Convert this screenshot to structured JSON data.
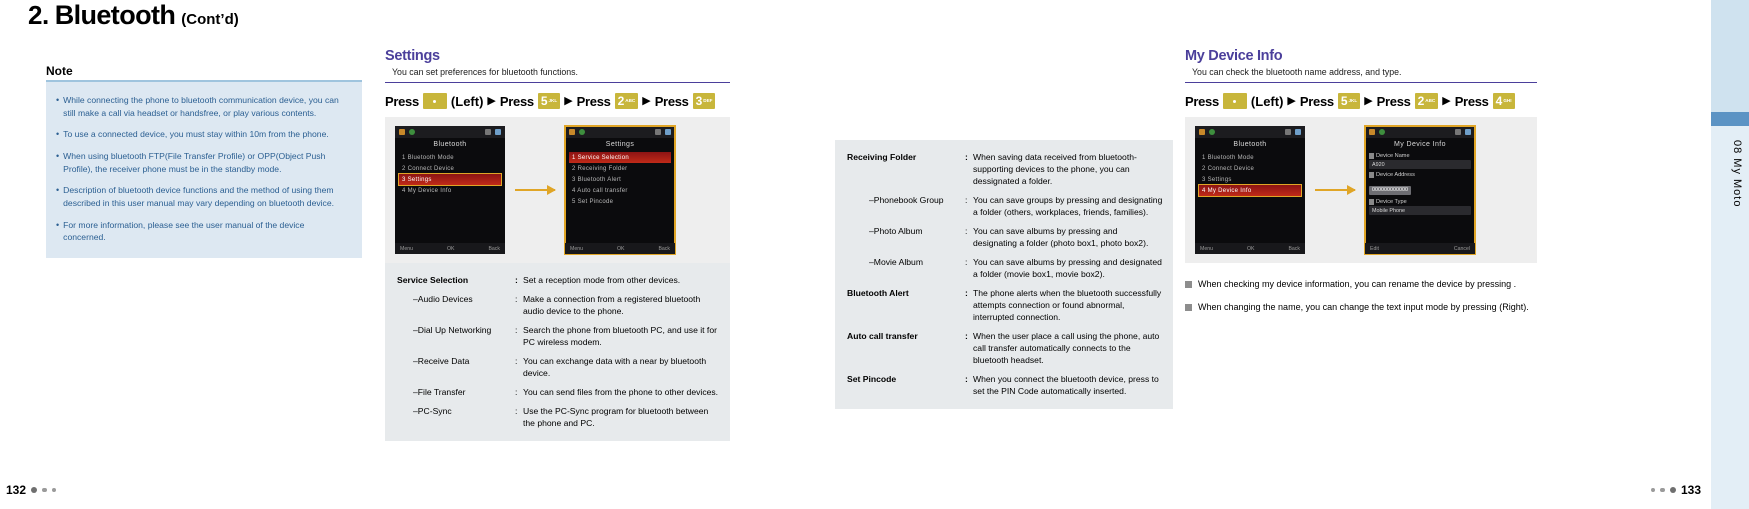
{
  "header": {
    "number": "2.",
    "title": "Bluetooth",
    "cont": "(Cont’d)"
  },
  "note": {
    "label": "Note",
    "items": [
      "While connecting the phone to bluetooth communication device, you can still make a call via headset or handsfree, or play various contents.",
      "To use a connected device, you must stay within 10m from the phone.",
      "When using bluetooth FTP(File Transfer Profile) or OPP(Object Push Profile), the receiver phone must be in the standby mode.",
      "Description of bluetooth device functions and the method of using them described in this user manual may vary depending on bluetooth device.",
      "For more information, please see the user manual of the device concerned."
    ],
    "bullet": "•"
  },
  "settings": {
    "title": "Settings",
    "subtitle": "You can set preferences for bluetooth functions.",
    "press_label": "Press",
    "left_label": "(Left)",
    "arrow": "▶",
    "keys": [
      {
        "type": "nav",
        "digit": "",
        "letters": ""
      },
      {
        "type": "num",
        "digit": "5",
        "letters": "JKL"
      },
      {
        "type": "num",
        "digit": "2",
        "letters": "ABC"
      },
      {
        "type": "num",
        "digit": "3",
        "letters": "DEF"
      }
    ],
    "phone_left": {
      "title": "Bluetooth",
      "items": [
        "1 Bluetooth Mode",
        "2 Connect Device",
        "3 Settings",
        "4 My Device Info"
      ],
      "selected_index": 2,
      "soft_left": "Menu",
      "soft_mid": "OK",
      "soft_right": "Back"
    },
    "phone_right": {
      "title": "Settings",
      "items": [
        "1 Service Selection",
        "2 Receiving Folder",
        "3 Bluetooth Alert",
        "4 Auto call transfer",
        "5 Set Pincode"
      ],
      "selected_index": 0,
      "soft_left": "Menu",
      "soft_mid": "OK",
      "soft_right": "Back"
    },
    "definitions": [
      {
        "term": "Service Selection",
        "bold": true,
        "sub": false,
        "colon": ":",
        "desc": "Set a reception mode from other devices."
      },
      {
        "term": "–Audio Devices",
        "bold": false,
        "sub": true,
        "colon": ":",
        "desc": "Make a connection from a registered bluetooth audio device to the phone."
      },
      {
        "term": "–Dial Up Networking",
        "bold": false,
        "sub": true,
        "colon": ":",
        "desc": "Search the phone from bluetooth PC, and use it for PC wireless modem."
      },
      {
        "term": "–Receive Data",
        "bold": false,
        "sub": true,
        "colon": ":",
        "desc": "You can exchange data with a near by bluetooth device."
      },
      {
        "term": "–File Transfer",
        "bold": false,
        "sub": true,
        "colon": ":",
        "desc": "You can send files from the phone to other devices."
      },
      {
        "term": "–PC-Sync",
        "bold": false,
        "sub": true,
        "colon": ":",
        "desc": "Use the PC-Sync program for bluetooth between the phone and PC."
      }
    ]
  },
  "center": {
    "definitions": [
      {
        "term": "Receiving Folder",
        "bold": true,
        "sub": false,
        "colon": ":",
        "desc": "When saving data received from bluetooth-supporting devices to the phone, you can dessignated a folder."
      },
      {
        "term": "–Phonebook Group",
        "bold": false,
        "sub": true,
        "colon": ":",
        "desc": "You can save groups by pressing  and designating a folder (others, workplaces, friends, families)."
      },
      {
        "term": "–Photo Album",
        "bold": false,
        "sub": true,
        "colon": ":",
        "desc": "You can save albums by pressing  and designating a folder (photo box1, photo box2)."
      },
      {
        "term": "–Movie Album",
        "bold": false,
        "sub": true,
        "colon": ":",
        "desc": "You can save albums by pressing  and designated a folder (movie box1, movie box2)."
      },
      {
        "term": "Bluetooth Alert",
        "bold": true,
        "sub": false,
        "colon": ":",
        "desc": "The phone alerts when the bluetooth successfully attempts connection or found abnormal, interrupted connection."
      },
      {
        "term": "Auto call transfer",
        "bold": true,
        "sub": false,
        "colon": ":",
        "desc": "When the user place a call using the phone, auto call transfer automatically connects to the bluetooth headset."
      },
      {
        "term": "Set Pincode",
        "bold": true,
        "sub": false,
        "colon": ":",
        "desc": "When you connect the bluetooth device, press  to set the PIN Code automatically inserted."
      }
    ]
  },
  "device_info": {
    "title": "My Device Info",
    "subtitle": "You can check the bluetooth name address, and type.",
    "press_label": "Press",
    "left_label": "(Left)",
    "arrow": "▶",
    "keys": [
      {
        "type": "nav",
        "digit": "",
        "letters": ""
      },
      {
        "type": "num",
        "digit": "5",
        "letters": "JKL"
      },
      {
        "type": "num",
        "digit": "2",
        "letters": "ABC"
      },
      {
        "type": "num",
        "digit": "4",
        "letters": "GHI"
      }
    ],
    "phone_left": {
      "title": "Bluetooth",
      "items": [
        "1 Bluetooth Mode",
        "2 Connect Device",
        "3 Settings",
        "4 My Device Info"
      ],
      "selected_index": 3,
      "soft_left": "Menu",
      "soft_mid": "OK",
      "soft_right": "Back"
    },
    "phone_right": {
      "title": "My Device Info",
      "fields": [
        {
          "label": "Device Name",
          "value": "A920",
          "highlight": false
        },
        {
          "label": "Device Address",
          "value": "000000000000",
          "highlight": true
        },
        {
          "label": "Device Type",
          "value": "Mobile Phone",
          "highlight": false
        }
      ],
      "soft_left": "Edit",
      "soft_right": "Cancel"
    },
    "bullets": [
      "When checking my device information, you can rename the device by pressing  .",
      "When changing the name, you can change the text input mode by pressing  (Right)."
    ]
  },
  "sidetab": {
    "label": "08  My Moto"
  },
  "footer": {
    "page_left": "132",
    "page_right": "133"
  }
}
